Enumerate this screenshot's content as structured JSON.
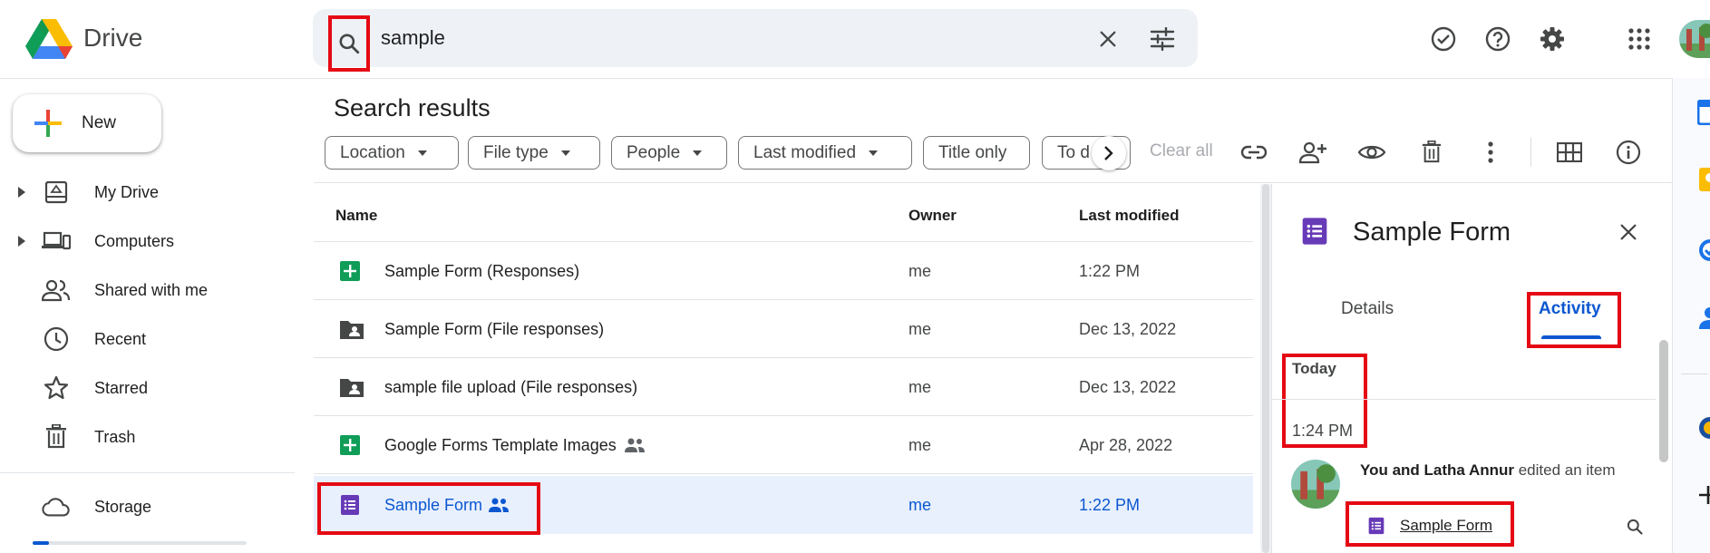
{
  "app": {
    "brand": "Drive"
  },
  "search": {
    "query": "sample"
  },
  "sidebar": {
    "new_label": "New",
    "items": [
      {
        "label": "My Drive",
        "icon": "my-drive-icon"
      },
      {
        "label": "Computers",
        "icon": "computers-icon"
      },
      {
        "label": "Shared with me",
        "icon": "shared-icon"
      },
      {
        "label": "Recent",
        "icon": "clock-icon"
      },
      {
        "label": "Starred",
        "icon": "star-icon"
      },
      {
        "label": "Trash",
        "icon": "trash-icon"
      }
    ],
    "storage_label": "Storage",
    "storage_used_fraction": 0.07
  },
  "main": {
    "title": "Search results",
    "filters": [
      "Location",
      "File type",
      "People",
      "Last modified",
      "Title only",
      "To d"
    ],
    "clear_all": "Clear all",
    "columns": {
      "name": "Name",
      "owner": "Owner",
      "modified": "Last modified"
    },
    "rows": [
      {
        "name": "Sample Form (Responses)",
        "owner": "me",
        "modified": "1:22 PM",
        "icon": "sheets-icon",
        "shared": false
      },
      {
        "name": "Sample Form (File responses)",
        "owner": "me",
        "modified": "Dec 13, 2022",
        "icon": "shared-folder-icon",
        "shared": false
      },
      {
        "name": "sample file upload (File responses)",
        "owner": "me",
        "modified": "Dec 13, 2022",
        "icon": "shared-folder-icon",
        "shared": false
      },
      {
        "name": "Google Forms Template Images",
        "owner": "me",
        "modified": "Apr 28, 2022",
        "icon": "sheets-icon",
        "shared": true
      },
      {
        "name": "Sample Form",
        "owner": "me",
        "modified": "1:22 PM",
        "icon": "forms-icon",
        "shared": true
      }
    ]
  },
  "details": {
    "title": "Sample Form",
    "tabs": [
      "Details",
      "Activity"
    ],
    "active_tab": "Activity",
    "section": "Today",
    "time": "1:24 PM",
    "activity_actor": "You and Latha Annur",
    "activity_action": " edited an item",
    "activity_item": "Sample Form"
  },
  "colors": {
    "accent": "#0b57d0",
    "selection": "#e8f0fe",
    "highlight": "#e50914",
    "forms": "#673ab7",
    "sheets": "#0f9d58"
  }
}
